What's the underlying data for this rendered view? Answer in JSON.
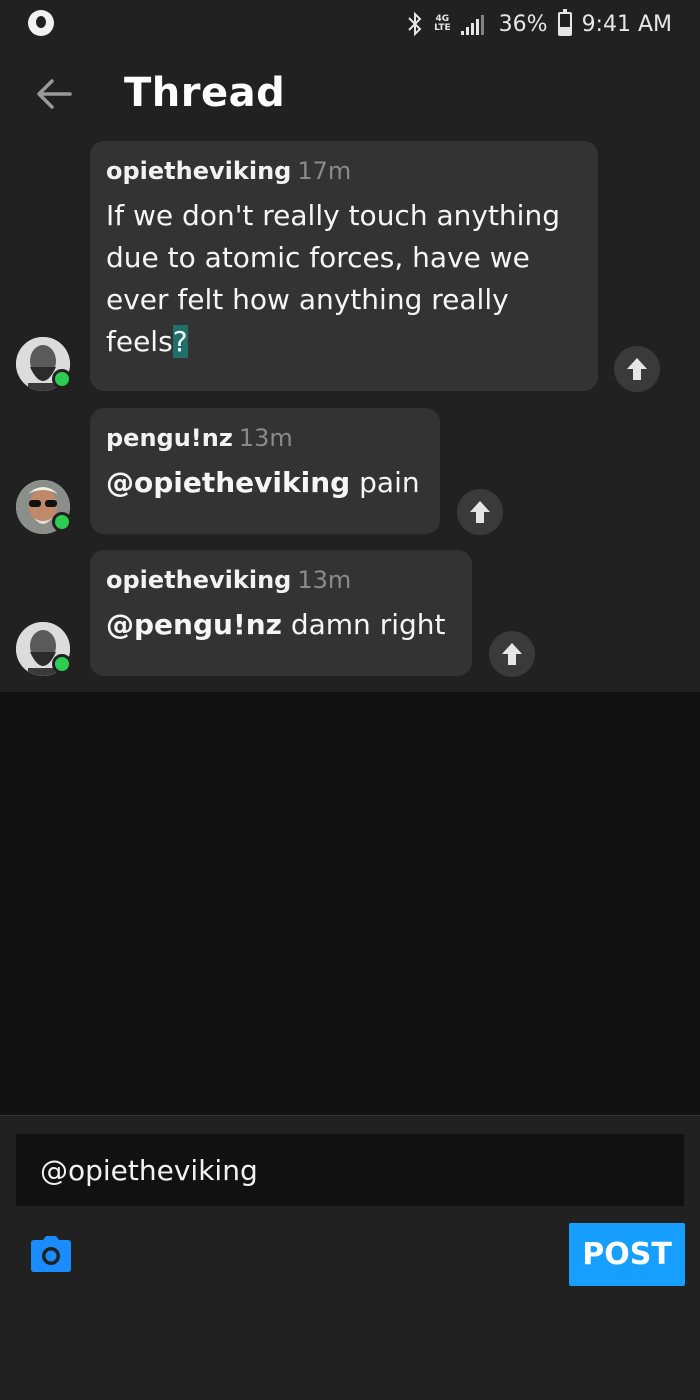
{
  "status_bar": {
    "network": "4G",
    "network_sub": "LTE",
    "battery": "36%",
    "time": "9:41 AM"
  },
  "header": {
    "title": "Thread"
  },
  "messages": [
    {
      "username": "opietheviking",
      "time": "17m",
      "text": "If we don't really touch anything due to atomic forces, have we ever felt how anything really feels",
      "text_last_char": "?"
    },
    {
      "username": "pengu!nz",
      "time": "13m",
      "mention": "@opietheviking",
      "text": " pain"
    },
    {
      "username": "opietheviking",
      "time": "13m",
      "mention": "@pengu!nz",
      "text": " damn right"
    }
  ],
  "composer": {
    "value": "@opietheviking",
    "post_label": "POST"
  },
  "colors": {
    "accent": "#169fff",
    "online": "#2ecc52",
    "bubble": "#333333",
    "panel": "#212121",
    "background": "#121212"
  }
}
